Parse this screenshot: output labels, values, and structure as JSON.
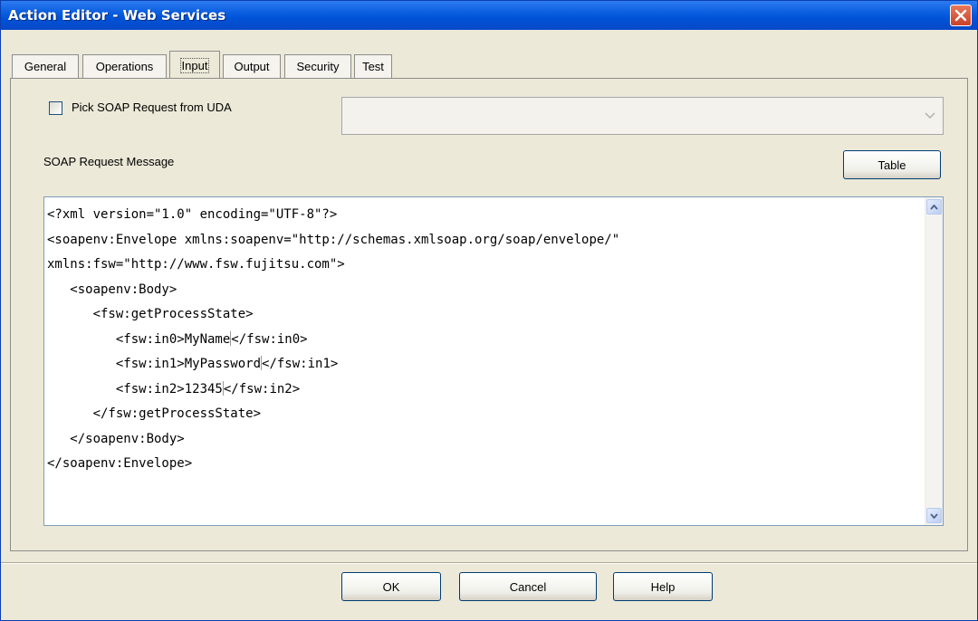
{
  "window": {
    "title": "Action Editor - Web Services"
  },
  "tabs": [
    {
      "label": "General"
    },
    {
      "label": "Operations"
    },
    {
      "label": "Input"
    },
    {
      "label": "Output"
    },
    {
      "label": "Security"
    },
    {
      "label": "Test"
    }
  ],
  "active_tab": "Input",
  "input": {
    "pick_checkbox_label": "Pick SOAP Request from UDA",
    "pick_checkbox_checked": false,
    "uda_combo_value": "",
    "section_label": "SOAP Request Message",
    "table_button_label": "Table",
    "xml_lines": [
      "<?xml version=\"1.0\" encoding=\"UTF-8\"?>",
      "<soapenv:Envelope xmlns:soapenv=\"http://schemas.xmlsoap.org/soap/envelope/\"",
      "xmlns:fsw=\"http://www.fsw.fujitsu.com\">",
      "   <soapenv:Body>",
      "      <fsw:getProcessState>",
      "         <fsw:in0>MyName",
      "</fsw:in0>",
      "         <fsw:in1>MyPassword",
      "</fsw:in1>",
      "         <fsw:in2>12345",
      "</fsw:in2>",
      "      </fsw:getProcessState>",
      "   </soapenv:Body>",
      "</soapenv:Envelope>"
    ]
  },
  "footer": {
    "ok_label": "OK",
    "cancel_label": "Cancel",
    "help_label": "Help"
  },
  "icons": {
    "close": "close-icon",
    "dropdown": "chevron-down-icon",
    "scroll_up": "scroll-up-icon",
    "scroll_down": "scroll-down-icon"
  },
  "colors": {
    "titlebar": "#0a5ee0",
    "close_button": "#d2553a",
    "dialog_bg": "#ece9d8"
  }
}
